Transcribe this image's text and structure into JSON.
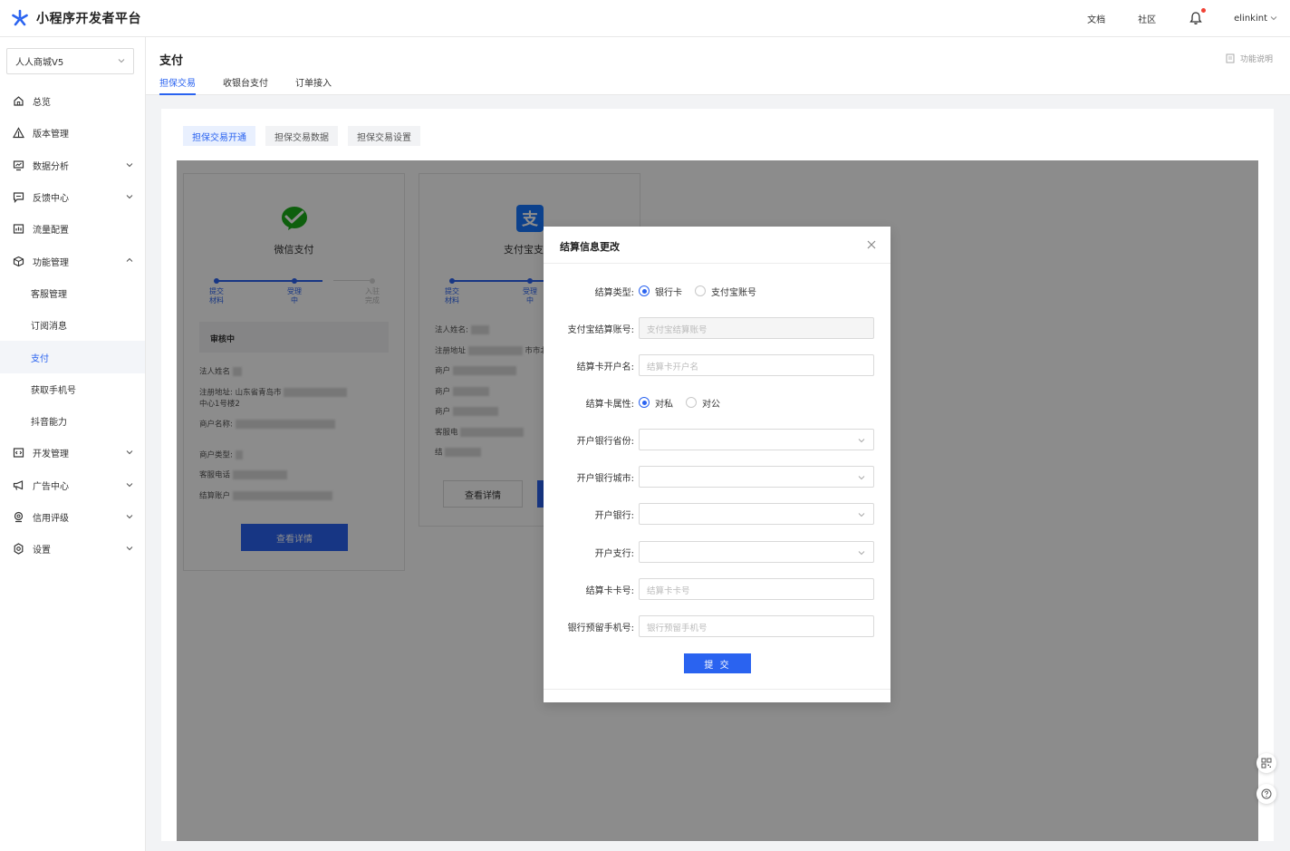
{
  "topbar": {
    "brand": "小程序开发者平台",
    "links": [
      "文档",
      "社区"
    ],
    "user": "elinkint"
  },
  "sidebar": {
    "app_select": "人人商城V5",
    "items": [
      {
        "label": "总览",
        "icon": "home-icon"
      },
      {
        "label": "版本管理",
        "icon": "version-icon"
      },
      {
        "label": "数据分析",
        "icon": "chart-icon",
        "expand": "down"
      },
      {
        "label": "反馈中心",
        "icon": "feedback-icon",
        "expand": "down"
      },
      {
        "label": "流量配置",
        "icon": "traffic-icon"
      },
      {
        "label": "功能管理",
        "icon": "cube-icon",
        "expand": "up"
      },
      {
        "label": "客服管理",
        "sub": true
      },
      {
        "label": "订阅消息",
        "sub": true
      },
      {
        "label": "支付",
        "sub": true,
        "active": true
      },
      {
        "label": "获取手机号",
        "sub": true
      },
      {
        "label": "抖音能力",
        "sub": true
      },
      {
        "label": "开发管理",
        "icon": "code-icon",
        "expand": "down"
      },
      {
        "label": "广告中心",
        "icon": "megaphone-icon",
        "expand": "down"
      },
      {
        "label": "信用评级",
        "icon": "badge-icon",
        "expand": "down"
      },
      {
        "label": "设置",
        "icon": "gear-icon",
        "expand": "down"
      }
    ]
  },
  "header": {
    "title": "支付",
    "help": "功能说明",
    "tabs": [
      "担保交易",
      "收银台支付",
      "订单接入"
    ],
    "active_tab": 0
  },
  "subtabs": [
    "担保交易开通",
    "担保交易数据",
    "担保交易设置"
  ],
  "wechat_card": {
    "name": "微信支付",
    "steps": [
      "提交\n材料",
      "受理\n中",
      "入驻\n完成"
    ],
    "status": "审核中",
    "rows": [
      "法人姓名",
      "注册地址: 山东省青岛市",
      "中心1号楼2",
      "商户名称:",
      "商户类型:",
      "客服电话",
      "结算账户"
    ],
    "button": "查看详情"
  },
  "alipay_card": {
    "name": "支付宝支",
    "steps": [
      "提交\n材料",
      "受理\n中"
    ],
    "rows": [
      "法人姓名:",
      "注册地址",
      "商户",
      "商户",
      "商户",
      "客服电",
      "结"
    ],
    "fragment": "市市北区",
    "button": "查看详情"
  },
  "modal": {
    "title": "结算信息更改",
    "fields": {
      "settle_type": {
        "label": "结算类型:",
        "options": [
          "银行卡",
          "支付宝账号"
        ],
        "selected": 0
      },
      "alipay_account": {
        "label": "支付宝结算账号:",
        "placeholder": "支付宝结算账号"
      },
      "account_name": {
        "label": "结算卡开户名:",
        "placeholder": "结算卡开户名"
      },
      "card_attr": {
        "label": "结算卡属性:",
        "options": [
          "对私",
          "对公"
        ],
        "selected": 0
      },
      "province": {
        "label": "开户银行省份:"
      },
      "city": {
        "label": "开户银行城市:"
      },
      "bank": {
        "label": "开户银行:"
      },
      "branch": {
        "label": "开户支行:"
      },
      "card_no": {
        "label": "结算卡卡号:",
        "placeholder": "结算卡卡号"
      },
      "phone": {
        "label": "银行预留手机号:",
        "placeholder": "银行预留手机号"
      }
    },
    "submit": "提 交"
  },
  "colors": {
    "primary": "#2a63f0",
    "wechat": "#1aad19",
    "alipay": "#1677ff",
    "notify": "#f04134"
  }
}
